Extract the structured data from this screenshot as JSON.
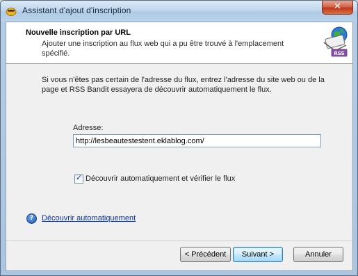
{
  "window": {
    "title": "Assistant d'ajout d'inscription",
    "close_label": "✕"
  },
  "header": {
    "title": "Nouvelle inscription par URL",
    "subtitle": "Ajouter une inscription au flux web qui a pu être trouvé à l'emplacement spécifié.",
    "badge_text": "RSS"
  },
  "intro": "Si vous n'êtes pas certain de l'adresse du flux, entrez l'adresse du site web ou de la page et RSS Bandit essayera de découvrir automatiquement le flux.",
  "address": {
    "label": "Adresse:",
    "value": "http://lesbeautestestent.eklablog.com/"
  },
  "autodiscover": {
    "label": "Découvrir automatiquement et vérifier le flux",
    "checked": true
  },
  "help": {
    "link_text": "Découvrir automatiquement",
    "icon_glyph": "?"
  },
  "buttons": {
    "previous": "< Précédent",
    "next": "Suivant >",
    "cancel": "Annuler"
  }
}
